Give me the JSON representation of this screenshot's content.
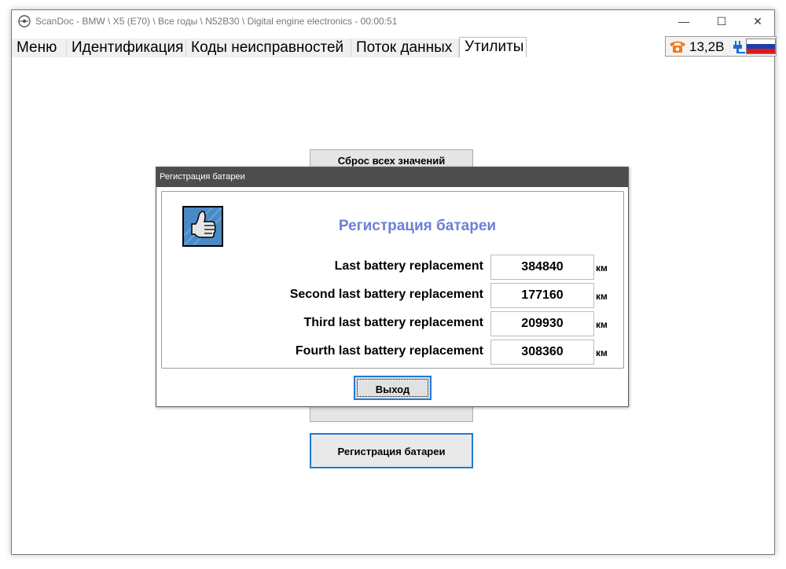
{
  "window": {
    "title": "ScanDoc - BMW \\ X5 (E70) \\ Все годы \\ N52B30 \\ Digital engine electronics - 00:00:51",
    "controls": {
      "minimize": "—",
      "maximize": "☐",
      "close": "✕"
    }
  },
  "tabs": [
    {
      "label": "Меню",
      "active": false
    },
    {
      "label": "Идентификация",
      "active": false
    },
    {
      "label": "Коды неисправностей",
      "active": false
    },
    {
      "label": "Поток данных",
      "active": false
    },
    {
      "label": "Утилиты",
      "active": true
    }
  ],
  "status": {
    "voltage": "13,2В",
    "icons": [
      "phone-icon",
      "power-plug-icon",
      "russia-flag-icon"
    ],
    "phone_color": "#f07a1a"
  },
  "background_buttons": {
    "reset_all": "Сброс всех значений",
    "battery_registration": "Регистрация батареи"
  },
  "dialog": {
    "title": "Регистрация батареи",
    "heading": "Регистрация батареи",
    "heading_color": "#6c7fd6",
    "icon": "thumbs-up-icon",
    "rows": [
      {
        "label": "Last battery replacement",
        "value": "384840",
        "unit": "км"
      },
      {
        "label": "Second last battery replacement",
        "value": "177160",
        "unit": "км"
      },
      {
        "label": "Third last battery replacement",
        "value": "209930",
        "unit": "км"
      },
      {
        "label": "Fourth last battery replacement",
        "value": "308360",
        "unit": "км"
      }
    ],
    "exit_label": "Выход"
  },
  "accent_color": "#1e7bd7"
}
